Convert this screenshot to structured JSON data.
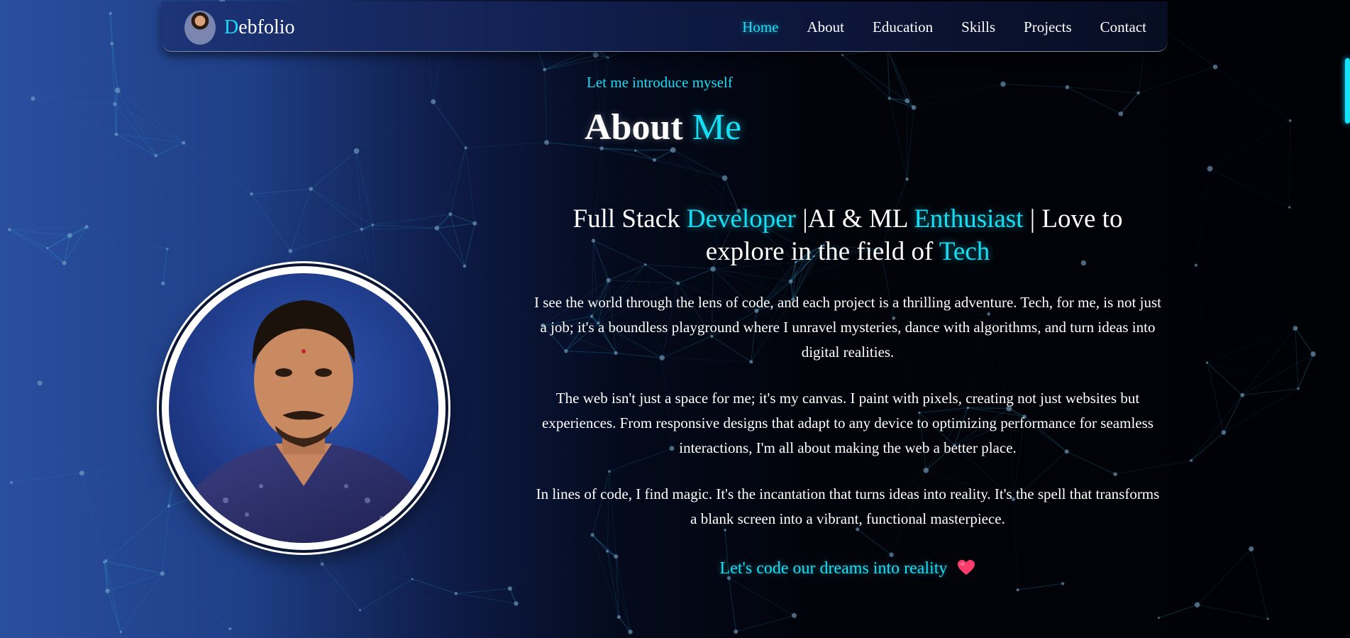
{
  "navbar": {
    "brand_initial": "D",
    "brand_rest": "ebfolio",
    "links": [
      {
        "label": "Home",
        "active": true
      },
      {
        "label": "About"
      },
      {
        "label": "Education"
      },
      {
        "label": "Skills"
      },
      {
        "label": "Projects"
      },
      {
        "label": "Contact"
      }
    ]
  },
  "about": {
    "intro": "Let me introduce myself",
    "title_main": "About",
    "title_accent": "Me",
    "tagline": {
      "t1": "Full Stack ",
      "a1": "Developer",
      "t2": " |AI & ML ",
      "a2": "Enthusiast",
      "t3": " | Love to explore in the field of ",
      "a3": "Tech"
    },
    "paragraphs": [
      "I see the world through the lens of code, and each project is a thrilling adventure. Tech, for me, is not just a job; it's a boundless playground where I unravel mysteries, dance with algorithms, and turn ideas into digital realities.",
      "The web isn't just a space for me; it's my canvas. I paint with pixels, creating not just websites but experiences. From responsive designs that adapt to any device to optimizing performance for seamless interactions, I'm all about making the web a better place.",
      "In lines of code, I find magic. It's the incantation that turns ideas into reality. It's the spell that transforms a blank screen into a vibrant, functional masterpiece."
    ],
    "cta": "Let's code our dreams into reality",
    "cta_icon": "heart-icon"
  },
  "colors": {
    "accent": "#16dff5",
    "heart": "#ff3b6b"
  }
}
